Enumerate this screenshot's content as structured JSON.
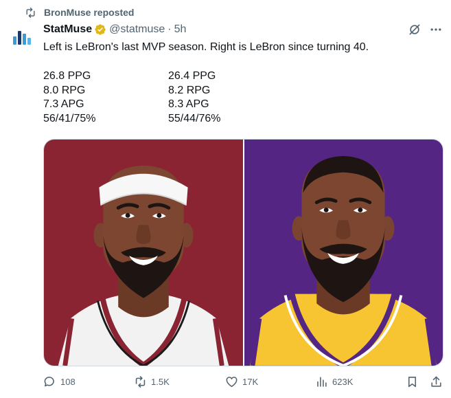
{
  "repost": {
    "text": "BronMuse reposted",
    "icon": "repost-icon"
  },
  "author": {
    "display_name": "StatMuse",
    "handle": "@statmuse",
    "separator": "·",
    "time": "5h",
    "verified": "gold-verified-badge",
    "avatar": "statmuse-logo"
  },
  "tweet": {
    "text": "Left is LeBron's last MVP season. Right is LeBron since turning 40.",
    "left_stats": [
      "26.8 PPG",
      "8.0 RPG",
      "7.3 APG",
      "56/41/75%"
    ],
    "right_stats": [
      "26.4 PPG",
      "8.2 RPG",
      "8.3 APG",
      "55/44/76%"
    ]
  },
  "media": {
    "left": {
      "description_icon": "lebron-heat-illustration",
      "background": "#8a2432",
      "jersey": "#ffffff"
    },
    "right": {
      "description_icon": "lebron-lakers-illustration",
      "background": "#552583",
      "jersey": "#f7c531"
    }
  },
  "actions": {
    "replies": "108",
    "reposts": "1.5K",
    "likes": "17K",
    "views": "623K"
  },
  "colors": {
    "text": "#0f1419",
    "muted": "#536471",
    "verified": "#e2b719",
    "logo_blue": "#3c9ad7",
    "logo_dark": "#173a6b"
  }
}
